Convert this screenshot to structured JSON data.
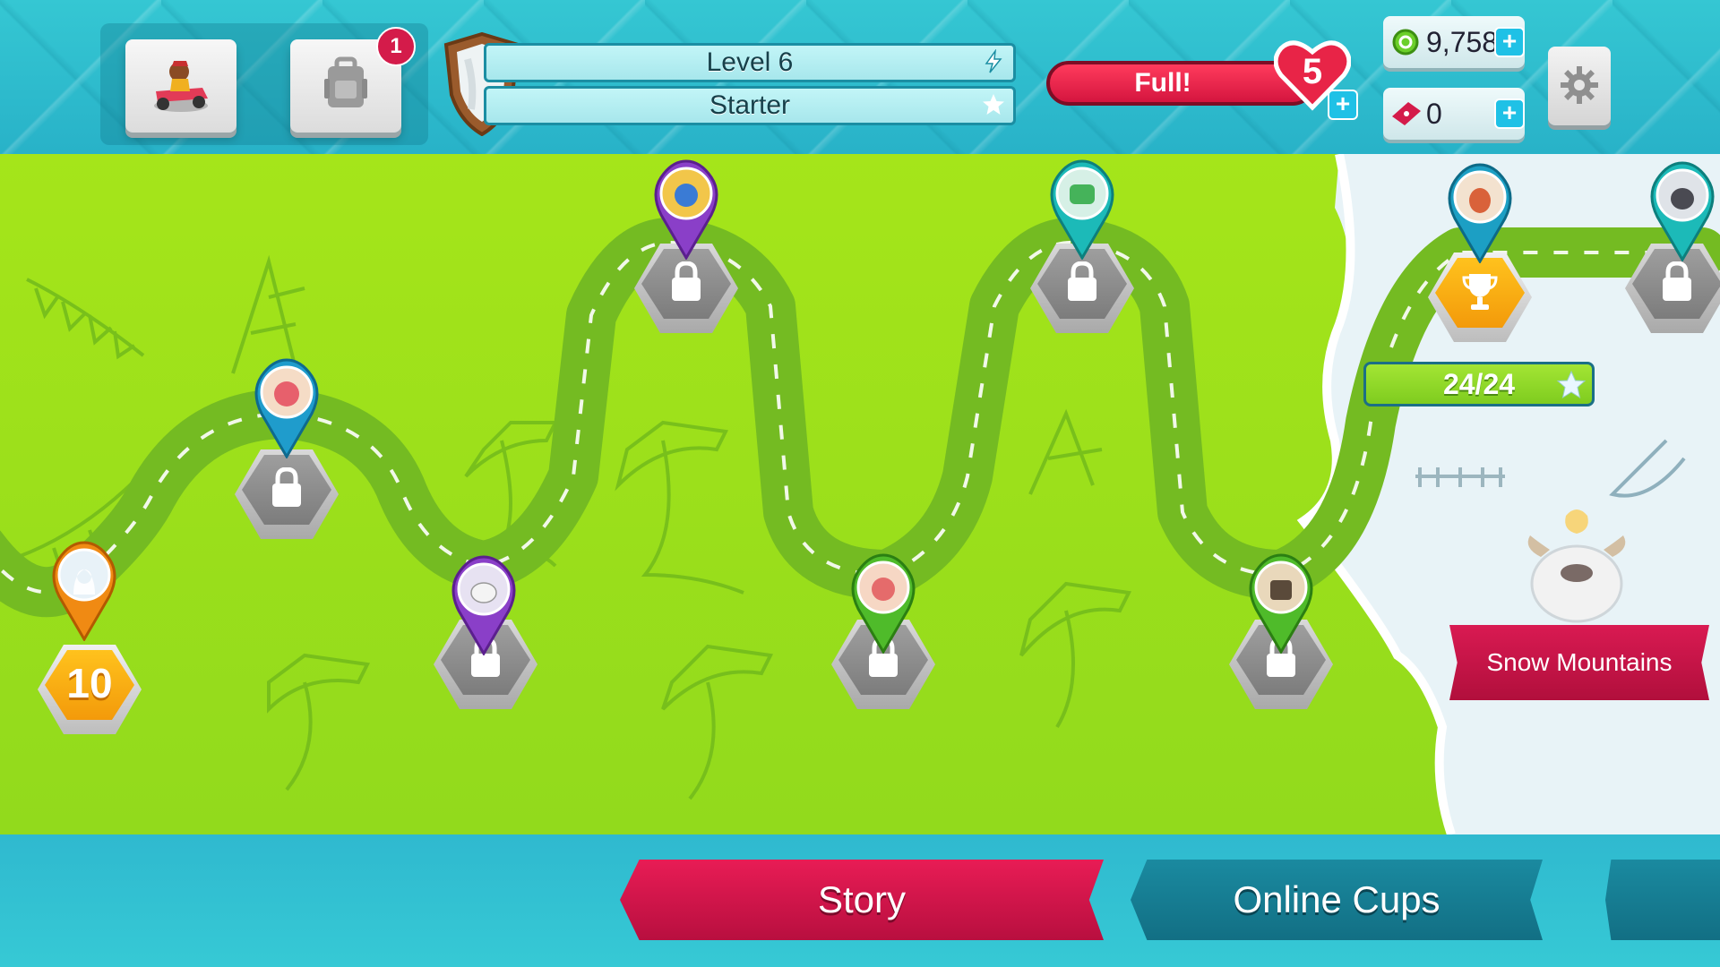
{
  "header": {
    "garage_badge": "1",
    "level_label": "Level 6",
    "rank_label": "Starter",
    "lives_status": "Full!",
    "lives_count": "5",
    "lives_plus": "+",
    "coins": "9,758",
    "coins_plus": "+",
    "tickets": "0",
    "tickets_plus": "+"
  },
  "map": {
    "current_level_number": "10",
    "progress_text": "24/24",
    "region_name": "Snow Mountains"
  },
  "nav": {
    "tabs": [
      {
        "label": "Story"
      },
      {
        "label": "Online Cups"
      },
      {
        "label": ""
      }
    ]
  },
  "colors": {
    "accent_red": "#d41b4a",
    "teal": "#28b2c8",
    "grass": "#9ee01b",
    "gold": "#f5a60c"
  }
}
